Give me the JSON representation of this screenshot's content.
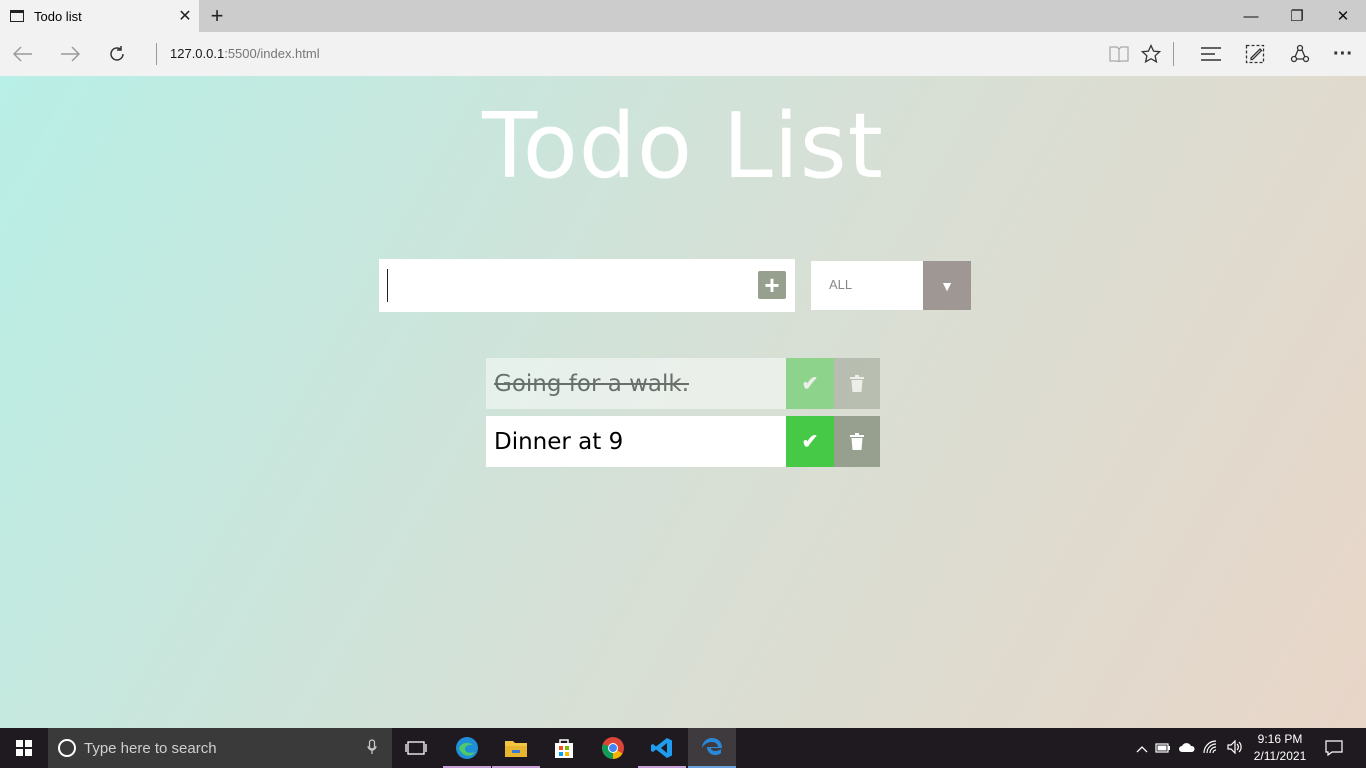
{
  "browser": {
    "tab_title": "Todo list",
    "tab_close": "✕",
    "new_tab": "+",
    "address_host": "127.0.0.1",
    "address_rest": ":5500/index.html",
    "window_controls": {
      "minimize": "—",
      "restore": "❐",
      "close": "✕"
    },
    "toolbar_more": "···"
  },
  "app": {
    "title": "Todo List",
    "input": {
      "value": "",
      "placeholder": ""
    },
    "add_button_label": "+",
    "filter": {
      "selected": "ALL",
      "arrow": "▼"
    },
    "todos": [
      {
        "text": "Going for a walk.",
        "completed": true
      },
      {
        "text": "Dinner at 9",
        "completed": false
      }
    ],
    "check_glyph": "✔"
  },
  "taskbar": {
    "search_placeholder": "Type here to search",
    "clock_time": "9:16 PM",
    "clock_date": "2/11/2021",
    "apps": [
      "task-view",
      "edge-chromium",
      "file-explorer",
      "microsoft-store",
      "chrome",
      "vscode",
      "edge-legacy"
    ]
  },
  "colors": {
    "gradient_start": "#b8efe6",
    "gradient_end": "#e8d6c8",
    "check_green": "#46c946",
    "trash_gray": "#97a08f",
    "filter_arrow": "#9e9794"
  }
}
